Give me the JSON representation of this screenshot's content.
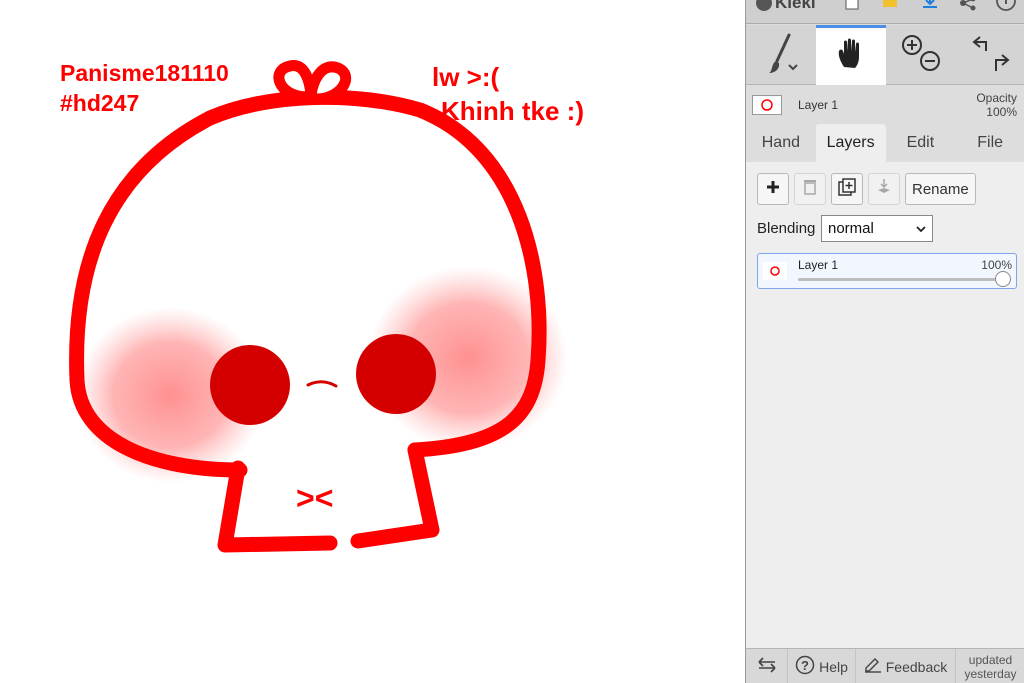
{
  "canvas": {
    "text_author": "Panisme181110",
    "text_tag": "#hd247",
    "text_line1": "lw >:(",
    "text_line2": "Khinh tke :)",
    "face_text": "><",
    "stroke_color": "#ff0000",
    "eye_color": "#d40000",
    "blush_color": "#ff8a8a"
  },
  "app": {
    "name": "Kleki",
    "accent_color": "#4b8ee6",
    "toolbar_icons": [
      "new-image-icon",
      "import-icon",
      "export-icon",
      "share-icon",
      "info-icon"
    ]
  },
  "tools": {
    "items": [
      {
        "name": "brush-tool",
        "icon": "brush-icon"
      },
      {
        "name": "hand-tool",
        "icon": "hand-icon",
        "active": true
      },
      {
        "name": "zoom-tool",
        "icon": "zoom-in-out-icon"
      },
      {
        "name": "undo-redo",
        "icon": "undo-redo-icon"
      }
    ]
  },
  "layer_preview": {
    "name": "Layer 1",
    "opacity_label": "Opacity",
    "opacity_value": "100%"
  },
  "tabs": [
    {
      "label": "Hand"
    },
    {
      "label": "Layers",
      "active": true
    },
    {
      "label": "Edit"
    },
    {
      "label": "File"
    }
  ],
  "layers_panel": {
    "rename_label": "Rename",
    "blending_label": "Blending",
    "blending_value": "normal",
    "layer": {
      "name": "Layer 1",
      "opacity": "100%",
      "opacity_fraction": 1.0
    }
  },
  "bottom": {
    "help_label": "Help",
    "feedback_label": "Feedback",
    "updated_line1": "updated",
    "updated_line2": "yesterday"
  }
}
